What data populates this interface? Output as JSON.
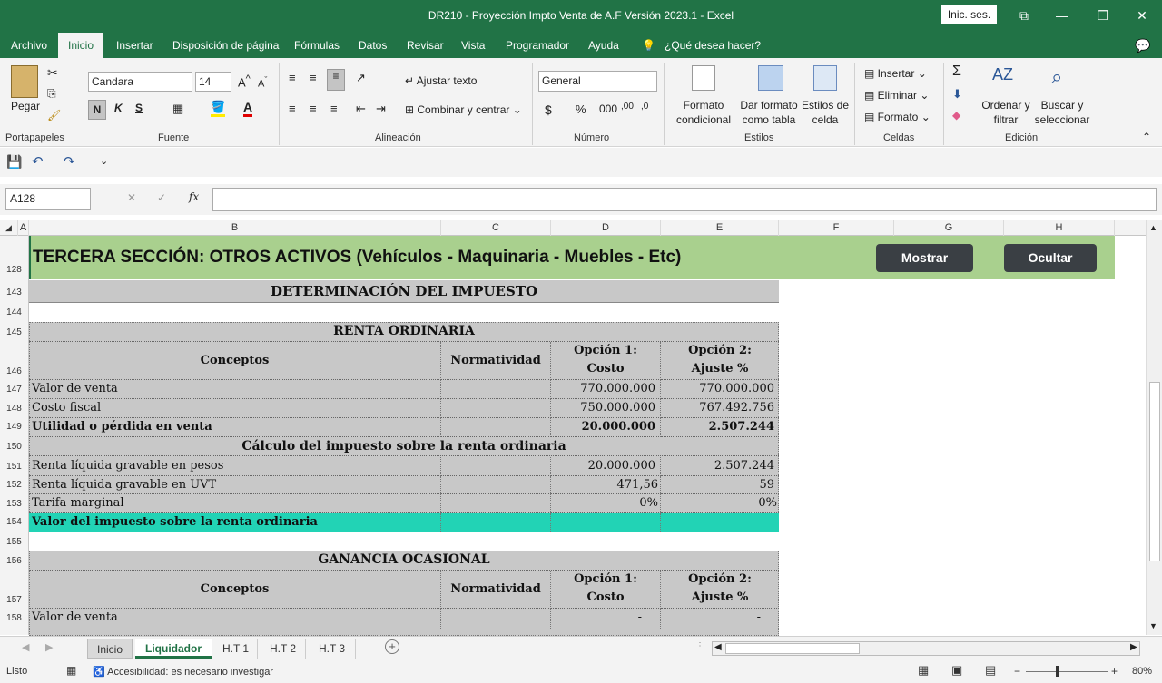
{
  "window": {
    "title": "DR210 - Proyección Impto Venta de A.F Versión 2023.1  -  Excel",
    "signin": "Inic. ses."
  },
  "menu": {
    "tabs": [
      "Archivo",
      "Inicio",
      "Insertar",
      "Disposición de página",
      "Fórmulas",
      "Datos",
      "Revisar",
      "Vista",
      "Programador",
      "Ayuda"
    ],
    "tell_me": "¿Qué desea hacer?"
  },
  "ribbon": {
    "clipboard": {
      "paste": "Pegar",
      "group": "Portapapeles"
    },
    "font": {
      "name": "Candara",
      "size": "14",
      "bold": "N",
      "italic": "K",
      "underline": "S",
      "group": "Fuente"
    },
    "alignment": {
      "wrap": "Ajustar texto",
      "merge": "Combinar y centrar",
      "group": "Alineación"
    },
    "number": {
      "format": "General",
      "group": "Número"
    },
    "styles": {
      "cond1": "Formato",
      "cond2": "condicional",
      "table1": "Dar formato",
      "table2": "como tabla",
      "cell1": "Estilos de",
      "cell2": "celda",
      "group": "Estilos"
    },
    "cells": {
      "insert": "Insertar",
      "delete": "Eliminar",
      "format": "Formato",
      "group": "Celdas"
    },
    "editing": {
      "sort1": "Ordenar y",
      "sort2": "filtrar",
      "find1": "Buscar y",
      "find2": "seleccionar",
      "group": "Edición"
    }
  },
  "formula_bar": {
    "name_box": "A128",
    "fx": "fx",
    "value": ""
  },
  "columns": [
    "A",
    "B",
    "C",
    "D",
    "E",
    "F",
    "G",
    "H"
  ],
  "rows": [
    "128",
    "143",
    "144",
    "145",
    "146",
    "147",
    "148",
    "149",
    "150",
    "151",
    "152",
    "153",
    "154",
    "155",
    "156",
    "157",
    "158"
  ],
  "sheet": {
    "header": "TERCERA SECCIÓN: OTROS ACTIVOS (Vehículos - Maquinaria - Muebles - Etc)",
    "btn_show": "Mostrar",
    "btn_hide": "Ocultar",
    "section_title": "DETERMINACIÓN DEL IMPUESTO",
    "renta": {
      "title": "RENTA ORDINARIA",
      "h_conceptos": "Conceptos",
      "h_norm": "Normatividad",
      "h_op1a": "Opción 1:",
      "h_op1b": "Costo",
      "h_op2a": "Opción 2:",
      "h_op2b": "Ajuste %",
      "r147": {
        "label": "Valor de venta",
        "d": "770.000.000",
        "e": "770.000.000"
      },
      "r148": {
        "label": "Costo fiscal",
        "d": "750.000.000",
        "e": "767.492.756"
      },
      "r149": {
        "label": "Utilidad o pérdida en venta",
        "d": "20.000.000",
        "e": "2.507.244"
      },
      "r150": "Cálculo del impuesto sobre la renta ordinaria",
      "r151": {
        "label": "Renta líquida gravable en pesos",
        "d": "20.000.000",
        "e": "2.507.244"
      },
      "r152": {
        "label": "Renta líquida gravable en UVT",
        "d": "471,56",
        "e": "59"
      },
      "r153": {
        "label": "Tarifa marginal",
        "d": "0%",
        "e": "0%"
      },
      "r154": {
        "label": "Valor del impuesto sobre la renta ordinaria",
        "d": "-",
        "e": "-"
      }
    },
    "ganancia": {
      "title": "GANANCIA OCASIONAL",
      "h_conceptos": "Conceptos",
      "h_norm": "Normatividad",
      "h_op1a": "Opción 1:",
      "h_op1b": "Costo",
      "h_op2a": "Opción 2:",
      "h_op2b": "Ajuste %",
      "r158": {
        "label": "Valor de venta",
        "d": "-",
        "e": "-"
      }
    }
  },
  "sheet_tabs": [
    "Inicio",
    "Liquidador",
    "H.T 1",
    "H.T 2",
    "H.T 3"
  ],
  "status": {
    "ready": "Listo",
    "accessibility": "Accesibilidad: es necesario investigar",
    "zoom": "80%"
  },
  "colors": {
    "excel_green": "#217346",
    "header_green": "#a9d08e",
    "highlight_teal": "#22d3b5",
    "gray_fill": "#c8c8c8"
  }
}
